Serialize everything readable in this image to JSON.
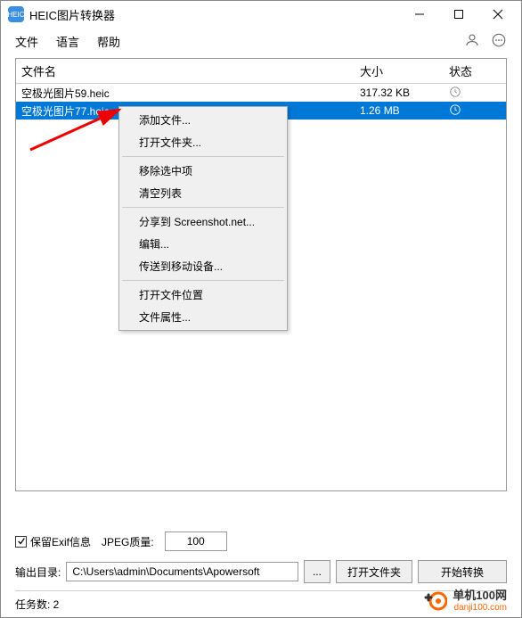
{
  "app": {
    "name": "HEIC",
    "title": "HEIC图片转换器"
  },
  "menu": {
    "file": "文件",
    "language": "语言",
    "help": "帮助"
  },
  "list": {
    "headers": {
      "name": "文件名",
      "size": "大小",
      "status": "状态"
    },
    "rows": [
      {
        "name": "空极光图片59.heic",
        "size": "317.32 KB"
      },
      {
        "name": "空极光图片77.heic",
        "size": "1.26 MB"
      }
    ]
  },
  "ctx": {
    "add": "添加文件...",
    "open_folder": "打开文件夹...",
    "remove_sel": "移除选中项",
    "clear_list": "清空列表",
    "share": "分享到 Screenshot.net...",
    "edit": "编辑...",
    "send_mobile": "传送到移动设备...",
    "open_location": "打开文件位置",
    "properties": "文件属性..."
  },
  "options": {
    "keep_exif": "保留Exif信息",
    "jpeg_quality_label": "JPEG质量:",
    "jpeg_quality": "100",
    "output_label": "输出目录:",
    "output_path": "C:\\Users\\admin\\Documents\\Apowersoft",
    "browse": "...",
    "open_folder_btn": "打开文件夹",
    "start": "开始转换"
  },
  "status": {
    "task_count_label": "任务数: 2"
  },
  "watermark": {
    "main": "单机100网",
    "sub": "danji100.com"
  }
}
